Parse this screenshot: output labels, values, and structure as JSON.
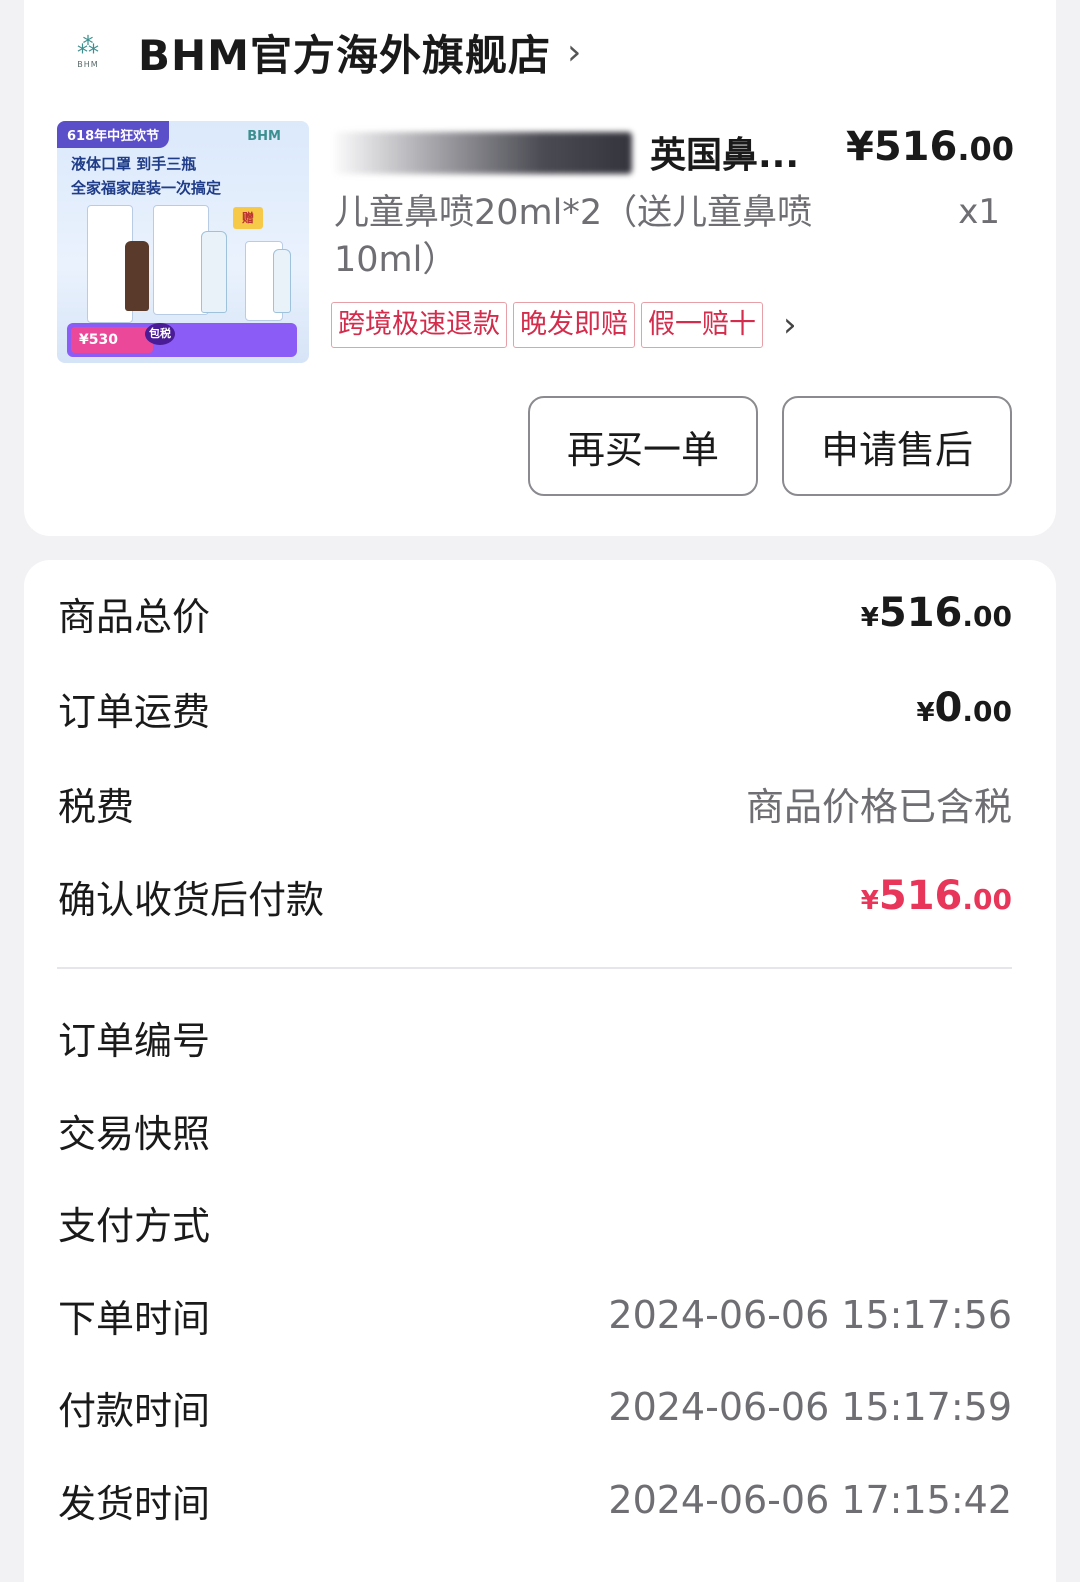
{
  "store": {
    "logo_text": "BHM",
    "name": "BHM官方海外旗舰店",
    "chevron": "›"
  },
  "product": {
    "image": {
      "badge": "618年中狂欢节",
      "brand": "BHM",
      "line1": "液体口罩 到手三瓶",
      "line2": "全家福家庭装一次搞定",
      "gift": "赠",
      "price_tag": "¥530",
      "package": "包税"
    },
    "title": "英国鼻...",
    "price_int": "¥516",
    "price_dec": ".00",
    "spec": "儿童鼻喷20ml*2（送儿童鼻喷10ml）",
    "quantity": "x1",
    "tags": [
      "跨境极速退款",
      "晚发即赔",
      "假一赔十"
    ],
    "tags_chevron": "›"
  },
  "actions": {
    "rebuy": "再买一单",
    "after_sale": "申请售后"
  },
  "summary": {
    "goods_total_label": "商品总价",
    "goods_total": {
      "yen": "¥",
      "int": "516",
      "dec": ".00"
    },
    "shipping_label": "订单运费",
    "shipping": {
      "yen": "¥",
      "int": "0",
      "dec": ".00"
    },
    "tax_label": "税费",
    "tax_value": "商品价格已含税",
    "pay_after_label": "确认收货后付款",
    "pay_after": {
      "yen": "¥",
      "int": "516",
      "dec": ".00"
    }
  },
  "order_info": {
    "order_no_label": "订单编号",
    "snapshot_label": "交易快照",
    "payment_method_label": "支付方式",
    "order_time_label": "下单时间",
    "order_time": "2024-06-06 15:17:56",
    "pay_time_label": "付款时间",
    "pay_time": "2024-06-06 15:17:59",
    "ship_time_label": "发货时间",
    "ship_time": "2024-06-06 17:15:42"
  },
  "colors": {
    "accent_red": "#e8355a",
    "tag_red": "#d42c4c",
    "background": "#f2f2f5"
  }
}
